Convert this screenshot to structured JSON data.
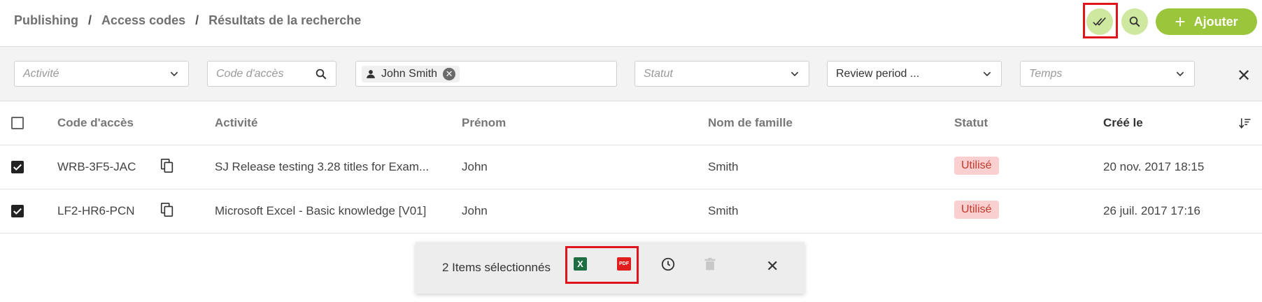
{
  "breadcrumb": [
    "Publishing",
    "Access codes",
    "Résultats de la recherche"
  ],
  "breadcrumb_separator": "/",
  "header": {
    "add_label": "Ajouter",
    "add_icon": "plus-icon",
    "accent": "#9bc63b"
  },
  "filters": {
    "activity_placeholder": "Activité",
    "code_placeholder": "Code d'accès",
    "person_chip": "John Smith",
    "status_placeholder": "Statut",
    "review_period_value": "Review period ...",
    "time_placeholder": "Temps"
  },
  "table": {
    "columns": [
      "Code d'accès",
      "Activité",
      "Prénom",
      "Nom de famille",
      "Statut",
      "Créé le"
    ],
    "rows": [
      {
        "code": "WRB-3F5-JAC",
        "activity": "SJ Release testing 3.28 titles for Exam...",
        "first_name": "John",
        "last_name": "Smith",
        "status": "Utilisé",
        "created": "20 nov. 2017 18:15",
        "checked": true
      },
      {
        "code": "LF2-HR6-PCN",
        "activity": "Microsoft Excel - Basic knowledge [V01]",
        "first_name": "John",
        "last_name": "Smith",
        "status": "Utilisé",
        "created": "26 juil. 2017 17:16",
        "checked": true
      }
    ]
  },
  "selection_bar": {
    "text": "2 Items sélectionnés",
    "xls_label": "X",
    "pdf_label": "PDF"
  },
  "colors": {
    "status_badge_bg": "#f9cfd0",
    "status_badge_text": "#c0392b",
    "highlight": "#e0141e"
  }
}
